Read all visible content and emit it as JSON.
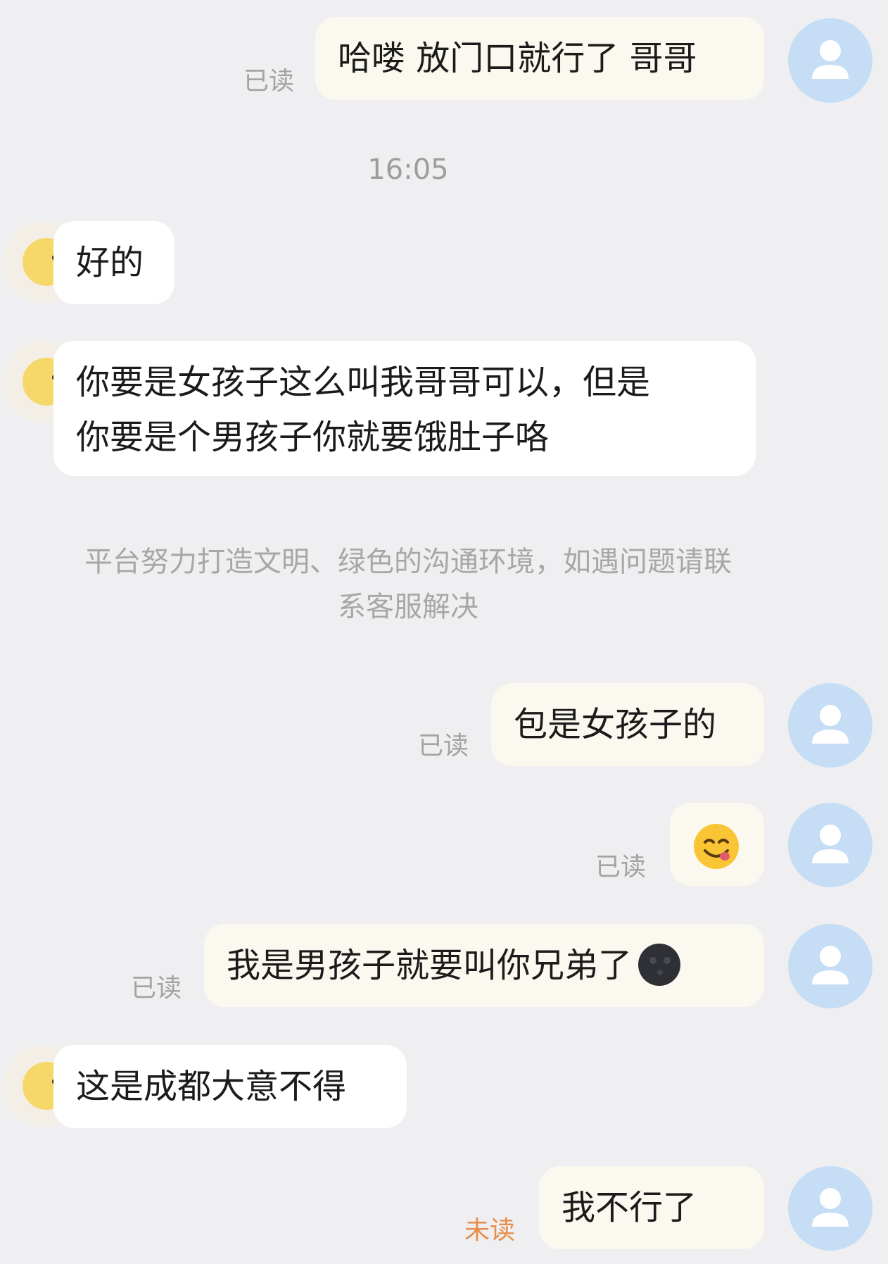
{
  "messages": {
    "m1": {
      "text": "哈喽 放门口就行了 哥哥",
      "status": "已读"
    },
    "time": "16:05",
    "m2": {
      "text": "好的"
    },
    "m3": {
      "line1": "你要是女孩子这么叫我哥哥可以，但是",
      "line2": "你要是个男孩子你就要饿肚子咯"
    },
    "notice": {
      "line1": "平台努力打造文明、绿色的沟通环境，如遇问题请联",
      "line2": "系客服解决"
    },
    "m4": {
      "text": "包是女孩子的",
      "status": "已读"
    },
    "m5": {
      "emoji": "yum-face-icon",
      "status": "已读"
    },
    "m6": {
      "text": "我是男孩子就要叫你兄弟了",
      "emoji": "new-moon-face-icon",
      "status": "已读"
    },
    "m7": {
      "text": "这是成都大意不得"
    },
    "m8": {
      "text": "我不行了",
      "status": "未读"
    }
  },
  "colors": {
    "background": "#efeff1",
    "my_bubble": "#fbf8ef",
    "peer_bubble": "#ffffff",
    "read_status": "#a3a3a3",
    "unread_status": "#e88d4a",
    "my_avatar": "#c5ddf5"
  }
}
